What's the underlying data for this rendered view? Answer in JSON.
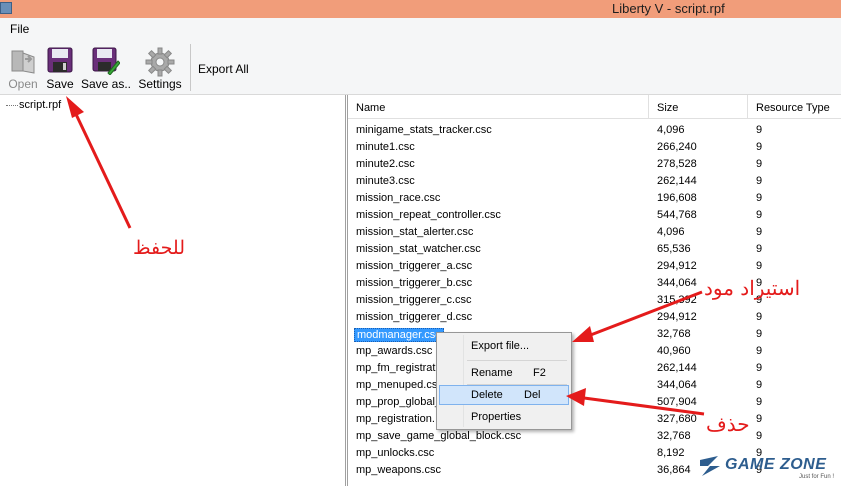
{
  "window": {
    "title": "Liberty V - script.rpf"
  },
  "menu": {
    "file": "File"
  },
  "toolbar": {
    "open": "Open",
    "save": "Save",
    "save_as": "Save as..",
    "settings": "Settings",
    "export_all": "Export All"
  },
  "tree": {
    "root": "script.rpf"
  },
  "columns": {
    "name": "Name",
    "size": "Size",
    "type": "Resource Type"
  },
  "rows": [
    {
      "name": "minigame_stats_tracker.csc",
      "size": "4,096",
      "type": "9"
    },
    {
      "name": "minute1.csc",
      "size": "266,240",
      "type": "9"
    },
    {
      "name": "minute2.csc",
      "size": "278,528",
      "type": "9"
    },
    {
      "name": "minute3.csc",
      "size": "262,144",
      "type": "9"
    },
    {
      "name": "mission_race.csc",
      "size": "196,608",
      "type": "9"
    },
    {
      "name": "mission_repeat_controller.csc",
      "size": "544,768",
      "type": "9"
    },
    {
      "name": "mission_stat_alerter.csc",
      "size": "4,096",
      "type": "9"
    },
    {
      "name": "mission_stat_watcher.csc",
      "size": "65,536",
      "type": "9"
    },
    {
      "name": "mission_triggerer_a.csc",
      "size": "294,912",
      "type": "9"
    },
    {
      "name": "mission_triggerer_b.csc",
      "size": "344,064",
      "type": "9"
    },
    {
      "name": "mission_triggerer_c.csc",
      "size": "315,392",
      "type": "9"
    },
    {
      "name": "mission_triggerer_d.csc",
      "size": "294,912",
      "type": "9"
    },
    {
      "name": "modmanager.csc",
      "size": "32,768",
      "type": "9"
    },
    {
      "name": "mp_awards.csc",
      "size": "40,960",
      "type": "9"
    },
    {
      "name": "mp_fm_registrat",
      "size": "262,144",
      "type": "9"
    },
    {
      "name": "mp_menuped.csc",
      "size": "344,064",
      "type": "9"
    },
    {
      "name": "mp_prop_global_",
      "size": "507,904",
      "type": "9"
    },
    {
      "name": "mp_registration.",
      "size": "327,680",
      "type": "9"
    },
    {
      "name": "mp_save_game_global_block.csc",
      "size": "32,768",
      "type": "9"
    },
    {
      "name": "mp_unlocks.csc",
      "size": "8,192",
      "type": "9"
    },
    {
      "name": "mp_weapons.csc",
      "size": "36,864",
      "type": "9"
    }
  ],
  "context_menu": {
    "export_file": "Export file...",
    "rename": "Rename",
    "rename_key": "F2",
    "delete": "Delete",
    "delete_key": "Del",
    "properties": "Properties"
  },
  "annotations": {
    "save": "للحفظ",
    "export_mod": "استيراد مود",
    "delete": "حذف"
  },
  "watermark": {
    "title": "GAME ZONE",
    "subtitle": "Just for Fun !"
  },
  "colors": {
    "titlebar": "#f19d7a",
    "selection": "#3399ff",
    "annotation": "#e41b1b",
    "watermark": "#2d5d8e"
  }
}
